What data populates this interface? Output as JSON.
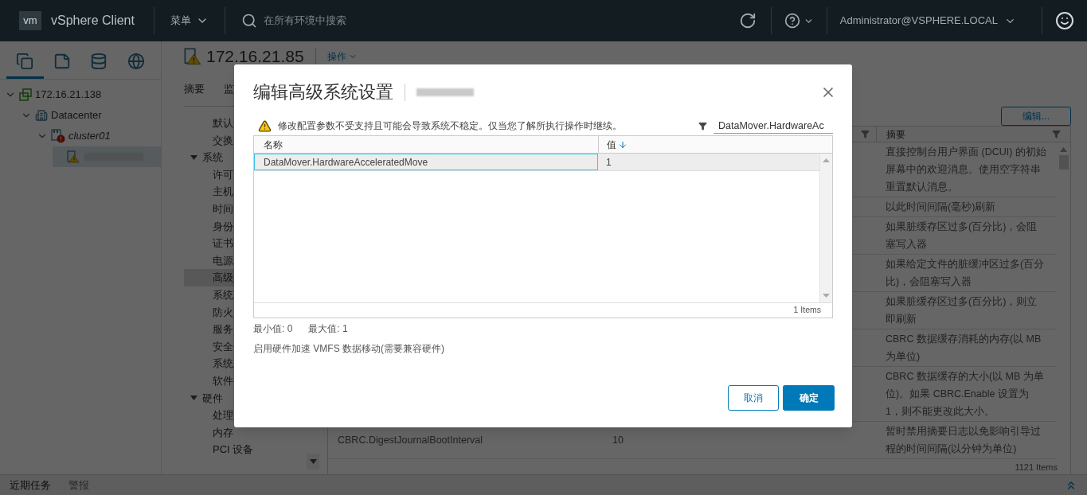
{
  "header": {
    "logo": "vm",
    "app_name": "vSphere Client",
    "menu": "菜单",
    "search_placeholder": "在所有环境中搜索",
    "user": "Administrator@VSPHERE.LOCAL"
  },
  "nav_tabs": [
    {
      "kind": "pages",
      "selected": true
    },
    {
      "kind": "note",
      "selected": false
    },
    {
      "kind": "storage",
      "selected": false
    },
    {
      "kind": "network",
      "selected": false
    }
  ],
  "tree": [
    {
      "label": "172.16.21.138",
      "kind": "vcenter",
      "expanded": true,
      "selected": false,
      "children": [
        {
          "label": "Datacenter",
          "kind": "datacenter",
          "expanded": true,
          "selected": false,
          "children": [
            {
              "label": "cluster01",
              "kind": "cluster",
              "expanded": true,
              "selected": false,
              "children": [
                {
                  "kind": "host",
                  "selected": true
                }
              ]
            }
          ]
        }
      ]
    }
  ],
  "object": {
    "title": "172.16.21.85",
    "actions": "操作"
  },
  "object_tabs": [
    "摘要",
    "监"
  ],
  "settings_nav": [
    {
      "label": "默认",
      "selected": false
    },
    {
      "label": "交换",
      "selected": false
    },
    {
      "label": "系统",
      "expanded": true,
      "children": [
        {
          "label": "许可",
          "selected": false
        },
        {
          "label": "主机",
          "selected": false
        },
        {
          "label": "时间",
          "selected": false
        },
        {
          "label": "身份",
          "selected": false
        },
        {
          "label": "证书",
          "selected": false
        },
        {
          "label": "电源",
          "selected": false
        },
        {
          "label": "高级",
          "selected": true
        },
        {
          "label": "系统",
          "selected": false
        },
        {
          "label": "防火",
          "selected": false
        },
        {
          "label": "服务",
          "selected": false
        },
        {
          "label": "安全",
          "selected": false
        },
        {
          "label": "系统",
          "selected": false
        },
        {
          "label": "软件",
          "selected": false
        }
      ]
    },
    {
      "label": "硬件",
      "expanded": true,
      "children": [
        {
          "label": "处理",
          "selected": false
        },
        {
          "label": "内存",
          "selected": false
        },
        {
          "label": "PCI 设备",
          "selected": false
        }
      ]
    }
  ],
  "edit_button": "编辑...",
  "table": {
    "summary_header": "摘要",
    "rows": [
      {
        "summary": "直接控制台用户界面 (DCUI) 的初始屏幕中的欢迎消息。使用空字符串重置默认消息。"
      },
      {
        "summary": "以此时间间隔(毫秒)刷新"
      },
      {
        "summary": "如果脏缓存区过多(百分比)，会阻塞写入器"
      },
      {
        "summary": "如果给定文件的脏缓冲区过多(百分比)，会阻塞写入器"
      },
      {
        "summary": "如果脏缓存区过多(百分比)，则立即刷新"
      },
      {
        "summary": "CBRC 数据缓存消耗的内存(以 MB 为单位)"
      },
      {
        "summary": "CBRC 数据缓存的大小(以 MB 为单位)。如果 CBRC.Enable 设置为 1，则不能更改此大小。"
      },
      {
        "name": "CBRC.DigestJournalBootInterval",
        "value": "10",
        "summary": "暂时禁用摘要日志以免影响引导过程的时间间隔(以分钟为单位)"
      }
    ],
    "footer": "1121 Items"
  },
  "dialog": {
    "title": "编辑高级系统设置",
    "warning": "修改配置参数不受支持且可能会导致系统不稳定。仅当您了解所执行操作时继续。",
    "filter_value": "DataMover.HardwareAc",
    "columns": [
      "名称",
      "值"
    ],
    "rows": [
      {
        "name": "DataMover.HardwareAcceleratedMove",
        "value": "1",
        "selected": true
      }
    ],
    "footer": "1 Items",
    "min": "最小值: 0",
    "max": "最大值: 1",
    "description": "启用硬件加速 VMFS 数据移动(需要兼容硬件)",
    "buttons": [
      {
        "label": "取消",
        "kind": "secondary"
      },
      {
        "label": "确定",
        "kind": "primary"
      }
    ]
  },
  "bottom_bar": {
    "tabs": [
      "近期任务",
      "警报"
    ]
  }
}
